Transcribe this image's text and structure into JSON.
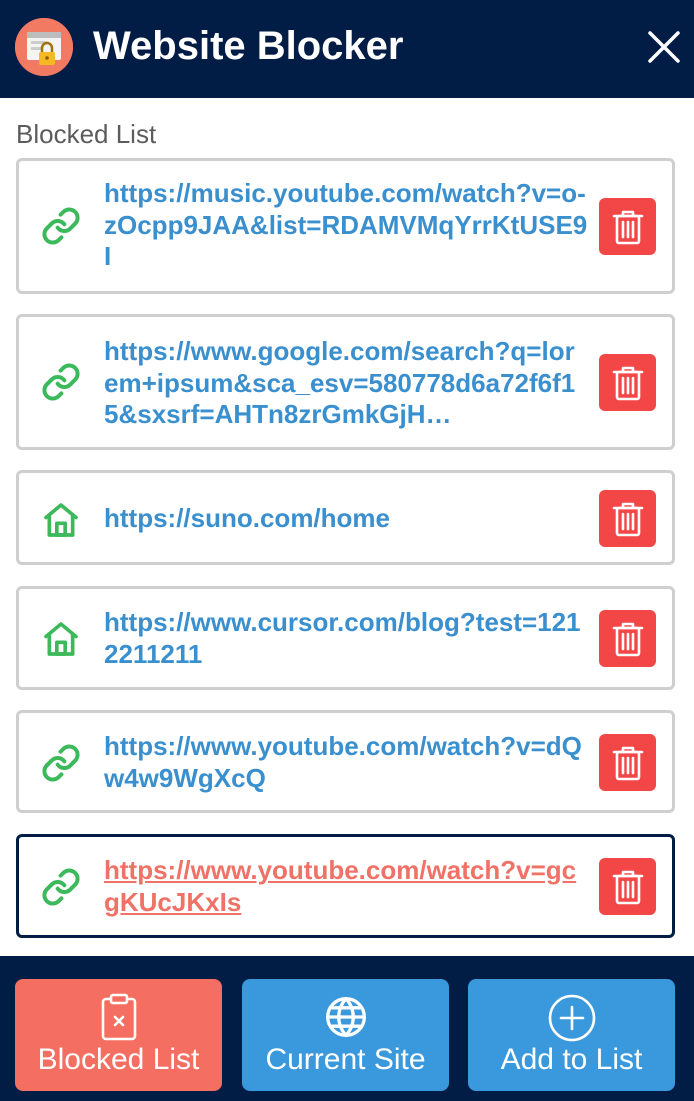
{
  "header": {
    "title": "Website Blocker",
    "logo_icon": "lock-window-icon",
    "close_icon": "close-icon"
  },
  "section": {
    "label": "Blocked List"
  },
  "blocked_list": [
    {
      "url": "https://music.youtube.com/watch?v=o-zOcpp9JAA&list=RDAMVMqYrrKtUSE9I",
      "type_icon": "link-icon"
    },
    {
      "url": "https://www.google.com/search?q=lorem+ipsum&sca_esv=580778d6a72f6f15&sxsrf=AHTn8zrGmkGjH…",
      "type_icon": "link-icon"
    },
    {
      "url": "https://suno.com/home",
      "type_icon": "home-icon"
    },
    {
      "url": "https://www.cursor.com/blog?test=1212211211",
      "type_icon": "home-icon"
    },
    {
      "url": "https://www.youtube.com/watch?v=dQw4w9WgXcQ",
      "type_icon": "link-icon"
    },
    {
      "url": "https://www.youtube.com/watch?v=gcgKUcJKxIs",
      "type_icon": "link-icon",
      "hovered": true
    }
  ],
  "footer": {
    "buttons": [
      {
        "label": "Blocked List",
        "icon": "clipboard-x-icon",
        "active": true
      },
      {
        "label": "Current Site",
        "icon": "globe-icon",
        "active": false
      },
      {
        "label": "Add to List",
        "icon": "plus-circle-icon",
        "active": false
      }
    ]
  },
  "colors": {
    "header_bg": "#021d45",
    "url_blue": "#3a8fce",
    "url_hover": "#f07166",
    "delete_red": "#f34647",
    "icon_green": "#3cb95b",
    "nav_active": "#f46f61",
    "nav_blue": "#3a98dc"
  }
}
